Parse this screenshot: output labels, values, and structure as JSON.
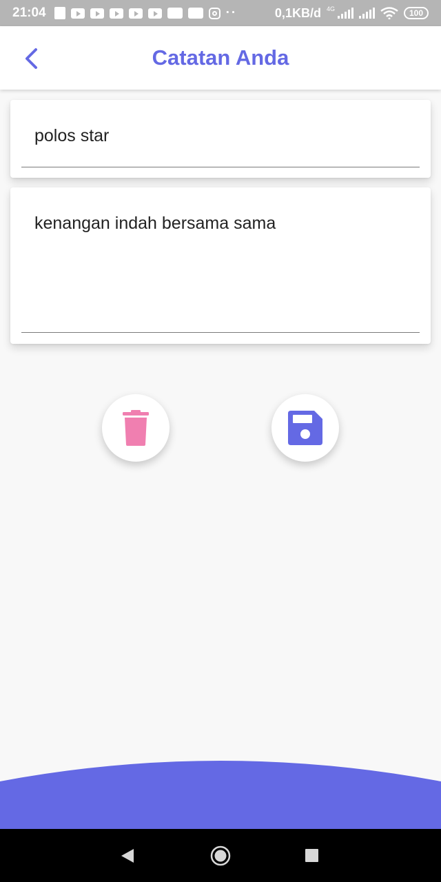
{
  "status_bar": {
    "time": "21:04",
    "dots": "··",
    "speed": "0,1KB/d",
    "network": "4G",
    "battery": "100"
  },
  "app_bar": {
    "title": "Catatan Anda",
    "back_icon": "chevron-left-icon"
  },
  "note": {
    "title_value": "polos star",
    "body_value": "kenangan indah bersama sama"
  },
  "actions": {
    "delete_icon": "trash-icon",
    "save_icon": "floppy-disk-icon"
  },
  "nav": {
    "back_icon": "triangle-back-icon",
    "home_icon": "circle-home-icon",
    "recent_icon": "square-recent-icon"
  },
  "colors": {
    "accent": "#6469e4",
    "delete": "#f07fb0",
    "status_bar": "#b5b5b5",
    "nav_bar": "#000000"
  }
}
